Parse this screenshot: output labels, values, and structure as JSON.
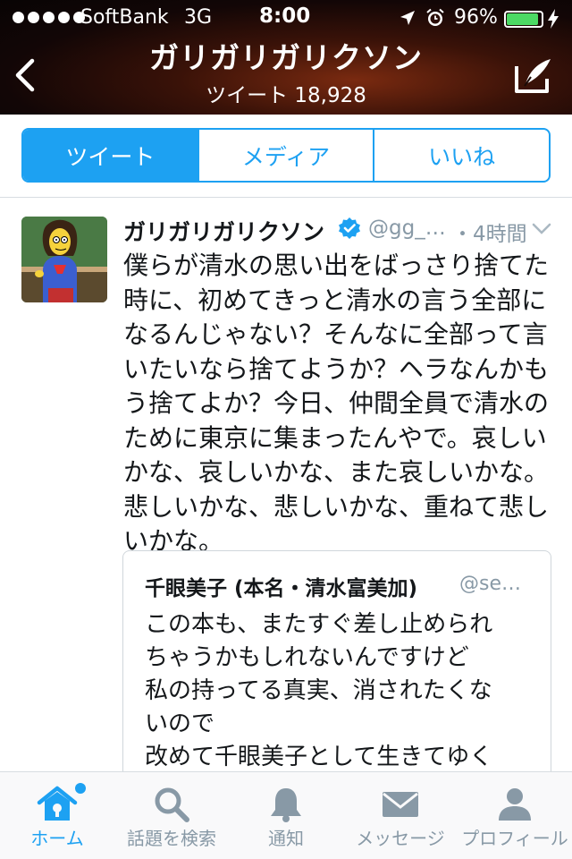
{
  "status_bar": {
    "carrier": "SoftBank",
    "network": "3G",
    "time": "8:00",
    "battery": "96%",
    "battery_level": 0.96
  },
  "header": {
    "title": "ガリガリガリクソン",
    "subtitle": "ツイート 18,928"
  },
  "segments": [
    "ツイート",
    "メディア",
    "いいね"
  ],
  "tweet": {
    "author": "ガリガリガリクソン",
    "handle": "@gg_…",
    "time": "・4時間",
    "lines": [
      "僕らが清水の思い出をばっさり捨てた",
      "時に、初めてきっと清水の言う全部に",
      "なるんじゃない？そんなに全部って言",
      "いたいなら捨てようか？ヘラなんかも",
      "う捨てよか？今日、仲間全員で清水の",
      "ために東京に集まったんやで。哀しい",
      "かな、哀しいかな、また哀しいかな。",
      "悲しいかな、悲しいかな、重ねて悲し",
      "いかな。"
    ],
    "quote": {
      "author": "千眼美子 (本名・清水富美加)",
      "handle": "@se…",
      "lines": [
        "この本も、またすぐ差し止められ",
        "ちゃうかもしれないんですけど",
        "私の持ってる真実、消されたくな",
        "いので",
        "改めて千眼美子として生きてゆく"
      ]
    }
  },
  "tab_bar": {
    "home": "ホーム",
    "search": "話題を検索",
    "notifications": "通知",
    "messages": "メッセージ",
    "profile": "プロフィール"
  },
  "colors": {
    "accent": "#1da1f2",
    "inactive": "#8899a6",
    "verified": "#1da1f2"
  }
}
